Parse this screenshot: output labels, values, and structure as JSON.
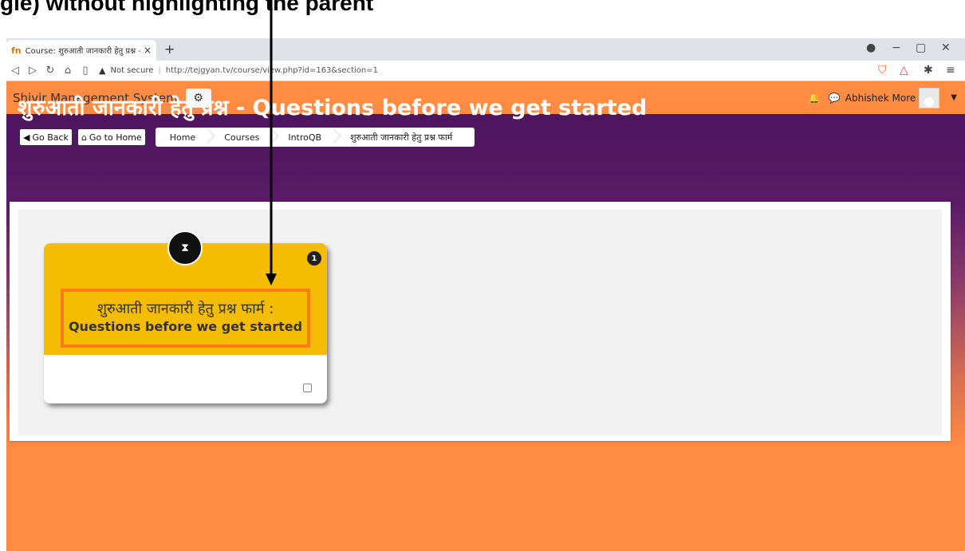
{
  "caption": {
    "text": "gle) without highlighting the parent"
  },
  "browser": {
    "tab_title": "Course: शुरुआती जानकारी हेतु प्रश्न - C",
    "favicon": "fn",
    "new_tab": "+",
    "close": "×",
    "address": {
      "security": "Not secure",
      "url": "http://tejgyan.tv/course/view.php?id=163&section=1"
    }
  },
  "navbar": {
    "brand": "Shivir Management System",
    "user_name": "Abhishek More"
  },
  "header": {
    "title": "शुरुआती जानकारी हेतु प्रश्न - Questions before we get started",
    "go_back": "Go Back",
    "go_home": "Go to Home",
    "breadcrumb": [
      "Home",
      "Courses",
      "IntroQB",
      "शुरुआती जानकारी हेतु प्रश्न फार्म"
    ]
  },
  "card": {
    "badge": "1",
    "title_hindi": "शुरुआती जानकारी हेतु प्रश्न फार्म :",
    "title_english": "Questions before we get started"
  },
  "colors": {
    "navbar": "#ff8c42",
    "header": "#4e1560",
    "card_top": "#f5bd02",
    "highlight": "#ff7a1a"
  },
  "icons": [
    "hourglass-icon",
    "gear-icon",
    "bell-icon",
    "chat-icon",
    "user-avatar-icon"
  ]
}
